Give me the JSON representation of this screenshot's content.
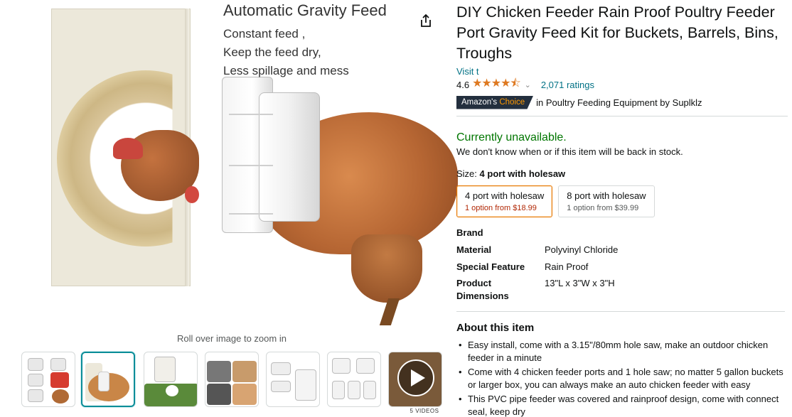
{
  "image": {
    "heading": "Automatic Gravity Feed",
    "lines": [
      "Constant feed ,",
      "Keep the feed dry,",
      "Less spillage and mess"
    ],
    "zoom_hint": "Roll over image to zoom in",
    "video_count": "5 VIDEOS",
    "thumbnail_count": 7,
    "selected_thumbnail": 2
  },
  "product": {
    "title": "DIY Chicken Feeder Rain Proof Poultry Feeder Port Gravity Feed Kit for Buckets, Barrels, Bins, Troughs",
    "store_link": "Visit t",
    "rating": "4.6",
    "stars": "★★★★⯪",
    "ratings_count": "2,071 ratings",
    "badge_left": "Amazon's",
    "badge_right": "Choice",
    "badge_text": "in Poultry Feeding Equipment by Suplklz"
  },
  "availability": {
    "status": "Currently unavailable.",
    "note": "We don't know when or if this item will be back in stock."
  },
  "size": {
    "label": "Size:",
    "selected": "4 port with holesaw",
    "options": [
      {
        "name": "4 port with holesaw",
        "price": "1 option from $18.99"
      },
      {
        "name": "8 port with holesaw",
        "price": "1 option from $39.99"
      }
    ]
  },
  "specs": [
    {
      "key": "Brand",
      "value": ""
    },
    {
      "key": "Material",
      "value": "Polyvinyl Chloride"
    },
    {
      "key": "Special Feature",
      "value": "Rain Proof"
    },
    {
      "key": "Product Dimensions",
      "value": "13\"L x 3\"W x 3\"H"
    }
  ],
  "about": {
    "heading": "About this item",
    "bullets": [
      "Easy install, come with a 3.15\"/80mm hole saw, make an outdoor chicken feeder in a minute",
      "Come with 4 chicken feeder ports and 1 hole saw; no matter 5 gallon buckets or larger box, you can always make an auto chicken feeder with easy",
      "This PVC pipe feeder was covered and rainproof design, come with connect seal, keep dry"
    ]
  },
  "colors": {
    "link": "#007185",
    "available_green": "#007600",
    "star": "#de7921",
    "badge_bg": "#232f3e",
    "badge_orange": "#ff9900",
    "selected_option_border": "#e77600",
    "price_red": "#b12704",
    "thumb_selected": "#0a8d98"
  },
  "icons": {
    "share": "share-icon",
    "play": "play-icon",
    "caret": "chevron-down-icon"
  }
}
